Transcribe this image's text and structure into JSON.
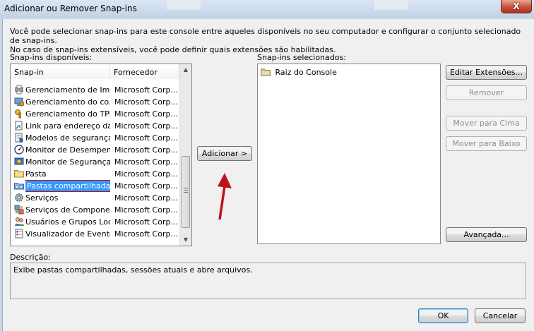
{
  "window": {
    "title": "Adicionar ou Remover Snap-ins",
    "close_label": "X"
  },
  "intro": {
    "line1": "Você pode selecionar snap-ins para este console entre aqueles disponíveis no seu computador e configurar o conjunto selecionado de snap-ins.",
    "line2": "No caso de snap-ins extensíveis, você pode definir quais extensões são habilitadas."
  },
  "available": {
    "label": "Snap-ins disponíveis:",
    "col_snapin": "Snap-in",
    "col_vendor": "Fornecedor",
    "items": [
      {
        "name": "Gerenciamento de Im...",
        "vendor": "Microsoft Corp...",
        "icon": "print-management-icon"
      },
      {
        "name": "Gerenciamento do co...",
        "vendor": "Microsoft Corp...",
        "icon": "computer-management-icon"
      },
      {
        "name": "Gerenciamento do TPM",
        "vendor": "Microsoft Corp...",
        "icon": "tpm-key-icon"
      },
      {
        "name": "Link para endereço da...",
        "vendor": "Microsoft Corp...",
        "icon": "link-page-icon"
      },
      {
        "name": "Modelos de segurança",
        "vendor": "Microsoft Corp...",
        "icon": "security-templates-icon"
      },
      {
        "name": "Monitor de Desempenho",
        "vendor": "Microsoft Corp...",
        "icon": "performance-monitor-icon"
      },
      {
        "name": "Monitor de Segurança IP",
        "vendor": "Microsoft Corp...",
        "icon": "ip-security-icon"
      },
      {
        "name": "Pasta",
        "vendor": "Microsoft Corp...",
        "icon": "folder-icon"
      },
      {
        "name": "Pastas compartilhadas",
        "vendor": "Microsoft Corp...",
        "icon": "shared-folders-icon"
      },
      {
        "name": "Serviços",
        "vendor": "Microsoft Corp...",
        "icon": "services-gear-icon"
      },
      {
        "name": "Serviços de Compone...",
        "vendor": "Microsoft Corp...",
        "icon": "component-services-icon"
      },
      {
        "name": "Usuários e Grupos Loc...",
        "vendor": "Microsoft Corp...",
        "icon": "users-groups-icon"
      },
      {
        "name": "Visualizador de Eventos",
        "vendor": "Microsoft Corp...",
        "icon": "event-viewer-icon"
      }
    ],
    "selected_index": 8
  },
  "buttons": {
    "add": "Adicionar >",
    "edit_extensions": "Editar Extensões...",
    "remove": "Remover",
    "move_up": "Mover para Cima",
    "move_down": "Mover para Baixo",
    "advanced": "Avançada...",
    "ok": "OK",
    "cancel": "Cancelar"
  },
  "selected_snapins": {
    "label": "Snap-ins selecionados:",
    "items": [
      {
        "name": "Raiz do Console",
        "icon": "folder-icon"
      }
    ]
  },
  "description": {
    "label": "Descrição:",
    "text": "Exibe pastas compartilhadas, sessões atuais e abre arquivos."
  },
  "colors": {
    "selection": "#3399ff",
    "highlight_box": "#c0121c",
    "arrow": "#c0121c"
  }
}
